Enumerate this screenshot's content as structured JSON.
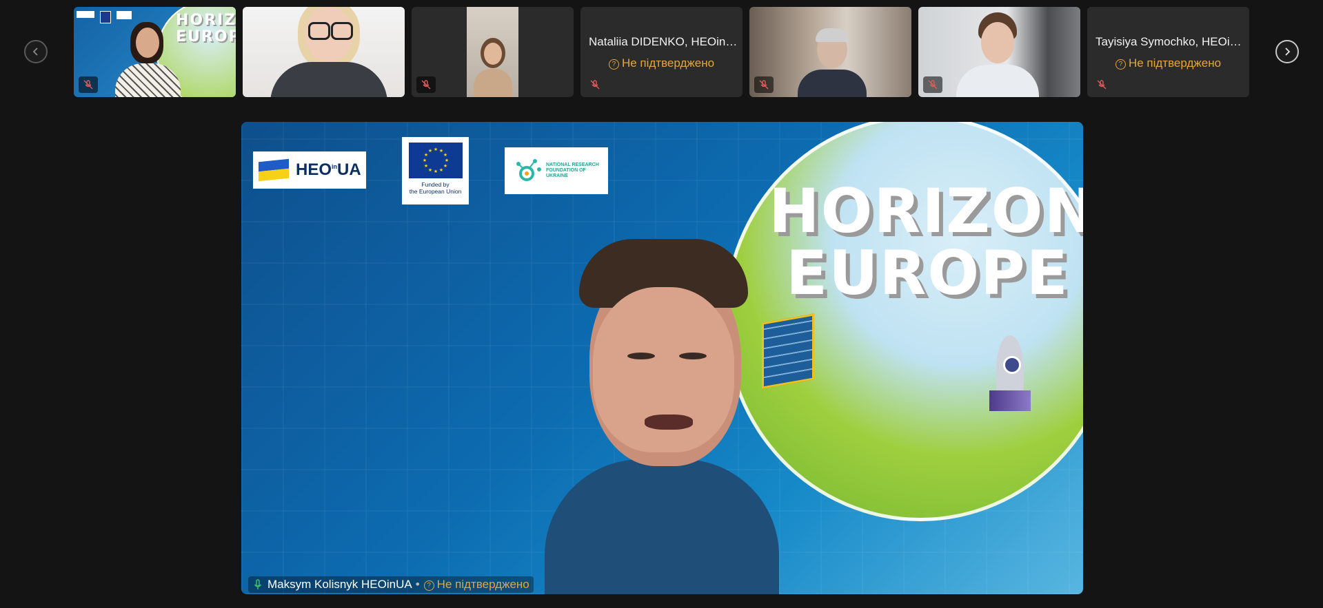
{
  "participants": [
    {
      "name": "",
      "status": "",
      "muted": true
    },
    {
      "name": "",
      "status": "",
      "muted": false
    },
    {
      "name": "",
      "status": "",
      "muted": true
    },
    {
      "name": "Nataliia DIDENKO, HEOin…",
      "status": "Не підтверджено",
      "muted": true
    },
    {
      "name": "",
      "status": "",
      "muted": true
    },
    {
      "name": "",
      "status": "",
      "muted": true
    },
    {
      "name": "Tayisiya Symochko, HEOi…",
      "status": "Не підтверджено",
      "muted": true
    }
  ],
  "main_video": {
    "speaker_name": "Maksym Kolisnyk HEOinUA",
    "separator": "•",
    "status": "Не підтверджено",
    "logos": {
      "heoinua": "HEO",
      "heoinua_suffix": "UA",
      "heoinua_small": "in",
      "eu_line1": "Funded by",
      "eu_line2": "the European Union",
      "nrfu": "NATIONAL RESEARCH FOUNDATION OF UKRAINE"
    },
    "banner_line1": "HORIZON",
    "banner_line2": "EUROPE"
  },
  "thumb_banner": {
    "line1": "HORIZON",
    "line2": "EUROPE"
  },
  "icons": {
    "prev": "chevron-left-icon",
    "next": "chevron-right-icon",
    "mute": "mic-off-icon",
    "mic": "mic-icon",
    "status": "question-circle-icon"
  },
  "colors": {
    "background": "#141414",
    "tile": "#2b2b2b",
    "warning": "#e8a53a",
    "mic_active": "#3cc06a"
  }
}
